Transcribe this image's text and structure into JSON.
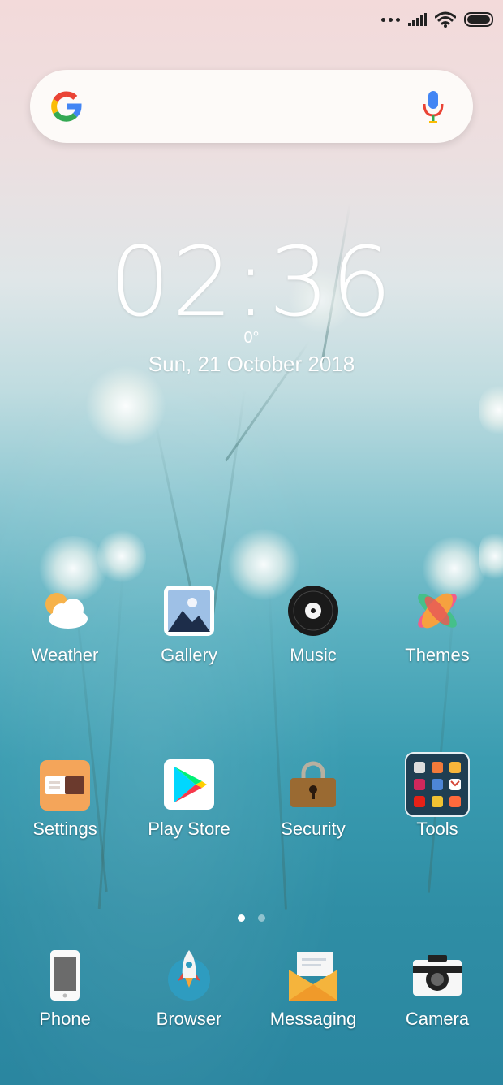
{
  "status_bar": {
    "icons": [
      "more-dots-icon",
      "cell-signal-icon",
      "wifi-icon",
      "battery-icon"
    ]
  },
  "search": {
    "logo": "google-logo-icon",
    "mic": "microphone-icon"
  },
  "clock": {
    "time": "02:36",
    "temperature": "0°",
    "date": "Sun, 21 October 2018"
  },
  "apps": {
    "row1": [
      {
        "label": "Weather",
        "icon": "weather-icon"
      },
      {
        "label": "Gallery",
        "icon": "gallery-icon"
      },
      {
        "label": "Music",
        "icon": "music-icon"
      },
      {
        "label": "Themes",
        "icon": "themes-icon"
      }
    ],
    "row2": [
      {
        "label": "Settings",
        "icon": "settings-icon"
      },
      {
        "label": "Play Store",
        "icon": "play-store-icon"
      },
      {
        "label": "Security",
        "icon": "security-icon"
      },
      {
        "label": "Tools",
        "icon": "tools-folder-icon"
      }
    ]
  },
  "pager": {
    "pages": 2,
    "current": 1
  },
  "dock": [
    {
      "label": "Phone",
      "icon": "phone-icon"
    },
    {
      "label": "Browser",
      "icon": "browser-icon"
    },
    {
      "label": "Messaging",
      "icon": "messaging-icon"
    },
    {
      "label": "Camera",
      "icon": "camera-icon"
    }
  ],
  "colors": {
    "accent_white": "#ffffff",
    "settings_orange": "#f4a55a",
    "messaging_yellow": "#f5b43c"
  }
}
